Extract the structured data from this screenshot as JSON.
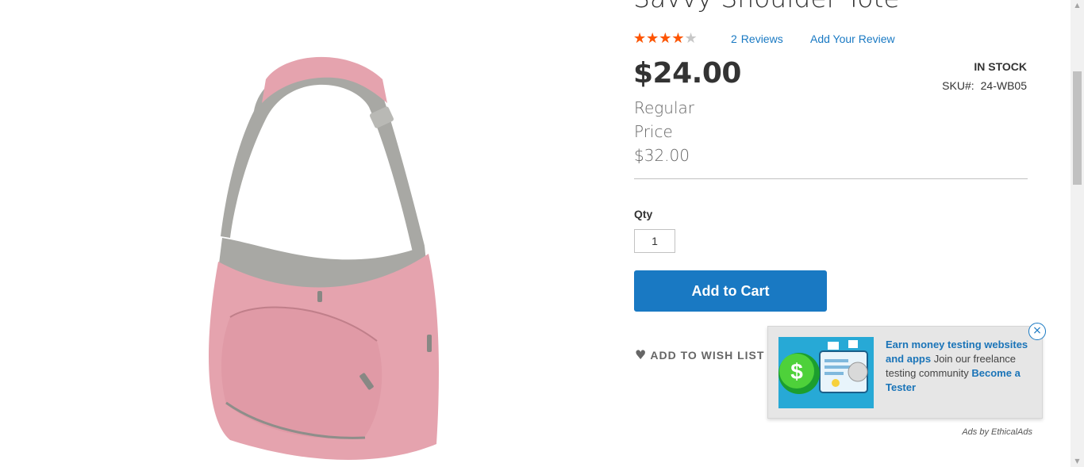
{
  "product": {
    "name": "Savvy Shoulder Tote",
    "image_alt": "pink shoulder tote bag",
    "rating_fraction": 0.8,
    "stars_glyph": "★★★★★",
    "reviews_count": "2",
    "reviews_label": "Reviews",
    "add_review_label": "Add Your Review",
    "final_price": "$24.00",
    "regular_price_label": "Regular Price",
    "regular_price": "$32.00",
    "stock_status": "In stock",
    "sku_label": "SKU#:",
    "sku_value": "24-WB05"
  },
  "cart": {
    "qty_label": "Qty",
    "qty_value": "1",
    "add_to_cart_label": "Add to Cart",
    "wishlist_label": "Add to Wish List",
    "heart_glyph": "♥"
  },
  "ad": {
    "headline": "Earn money testing websites and apps",
    "body": " Join our freelance testing community ",
    "cta": "Become a Tester",
    "close_glyph": "×",
    "attribution": "Ads by EthicalAds",
    "image_dollar": "$"
  },
  "scrollbar": {
    "up_glyph": "▲",
    "down_glyph": "▼"
  },
  "colors": {
    "accent": "#1979c3",
    "star_filled": "#ff5501",
    "star_empty": "#c7c7c7",
    "bag_pink": "#e5a3ae",
    "bag_gray": "#a8a8a4"
  }
}
